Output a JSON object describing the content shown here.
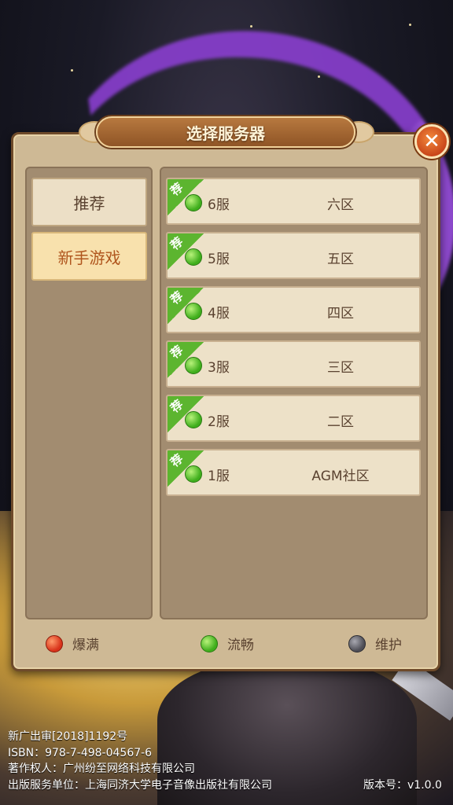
{
  "dialog": {
    "title": "选择服务器",
    "close_icon": "close-icon"
  },
  "tabs": [
    {
      "label": "推荐",
      "active": false
    },
    {
      "label": "新手游戏",
      "active": true
    }
  ],
  "servers": [
    {
      "badge": "荐",
      "status": "green",
      "name": "6服",
      "zone": "六区"
    },
    {
      "badge": "荐",
      "status": "green",
      "name": "5服",
      "zone": "五区"
    },
    {
      "badge": "荐",
      "status": "green",
      "name": "4服",
      "zone": "四区"
    },
    {
      "badge": "荐",
      "status": "green",
      "name": "3服",
      "zone": "三区"
    },
    {
      "badge": "荐",
      "status": "green",
      "name": "2服",
      "zone": "二区"
    },
    {
      "badge": "荐",
      "status": "green",
      "name": "1服",
      "zone": "AGM社区"
    }
  ],
  "legend": [
    {
      "status": "red",
      "label": "爆满"
    },
    {
      "status": "green",
      "label": "流畅"
    },
    {
      "status": "gray",
      "label": "维护"
    }
  ],
  "footer": {
    "lines": [
      "新广出审[2018]1192号",
      "ISBN：978-7-498-04567-6",
      "著作权人：广州纷至网络科技有限公司",
      "出版服务单位：上海同济大学电子音像出版社有限公司"
    ],
    "version": "版本号：v1.0.0"
  },
  "colors": {
    "status_green": "#3fae1c",
    "status_red": "#d8321a",
    "status_gray": "#4e4e56",
    "active_tab_text": "#b0561e",
    "title_bar": "#9a5e2c"
  }
}
